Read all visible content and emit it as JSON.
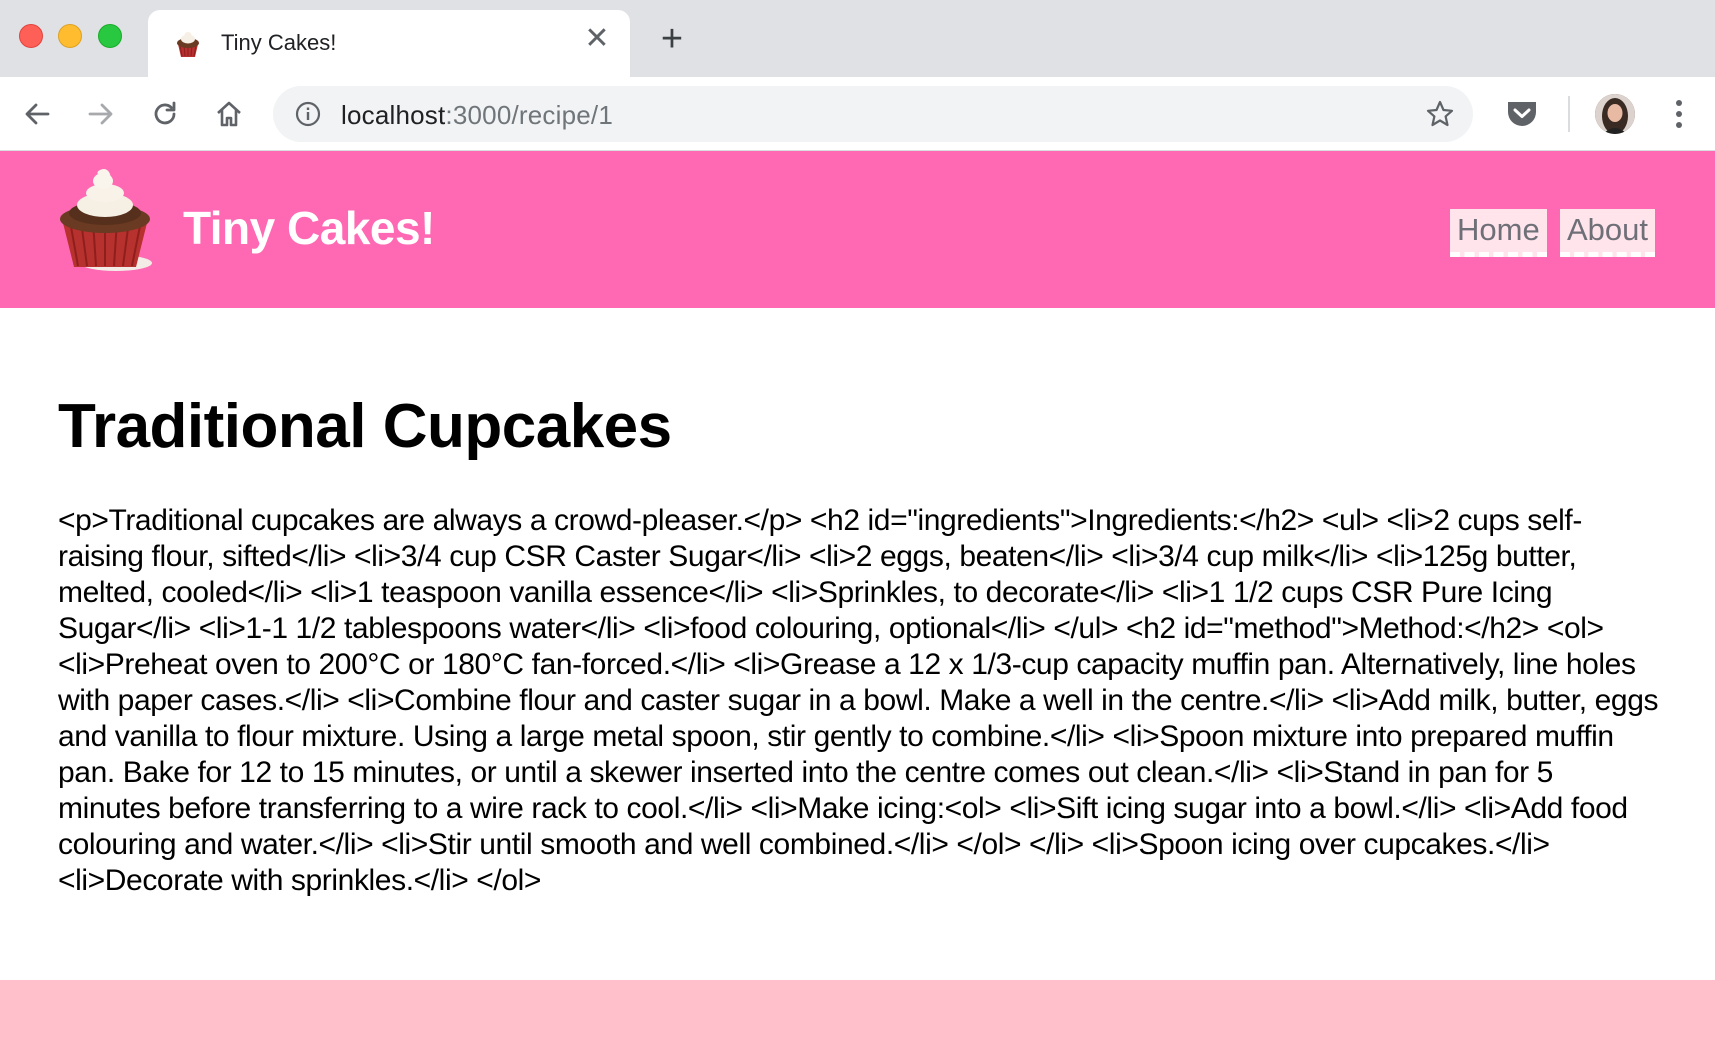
{
  "browser": {
    "tab_title": "Tiny Cakes!",
    "tab_close": "✕",
    "new_tab": "+",
    "url_host": "localhost",
    "url_rest": ":3000/recipe/1"
  },
  "site": {
    "title": "Tiny Cakes!",
    "nav": [
      {
        "label": "Home"
      },
      {
        "label": "About"
      }
    ],
    "brand_color": "#ff69b4",
    "footer_color": "#ffc0cb"
  },
  "recipe": {
    "title": "Traditional Cupcakes",
    "body": "<p>Traditional cupcakes are always a crowd-pleaser.</p> <h2 id=\"ingredients\">Ingredients:</h2> <ul> <li>2 cups self-raising flour, sifted</li> <li>3/4 cup CSR Caster Sugar</li> <li>2 eggs, beaten</li> <li>3/4 cup milk</li> <li>125g butter, melted, cooled</li> <li>1 teaspoon vanilla essence</li> <li>Sprinkles, to decorate</li> <li>1 1/2 cups CSR Pure Icing Sugar</li> <li>1-1 1/2 tablespoons water</li> <li>food colouring, optional</li> </ul> <h2 id=\"method\">Method:</h2> <ol> <li>Preheat oven to 200°C or 180°C fan-forced.</li> <li>Grease a 12 x 1/3-cup capacity muffin pan. Alternatively, line holes with paper cases.</li> <li>Combine flour and caster sugar in a bowl. Make a well in the centre.</li> <li>Add milk, butter, eggs and vanilla to flour mixture. Using a large metal spoon, stir gently to combine.</li> <li>Spoon mixture into prepared muffin pan. Bake for 12 to 15 minutes, or until a skewer inserted into the centre comes out clean.</li> <li>Stand in pan for 5 minutes before transferring to a wire rack to cool.</li> <li>Make icing:<ol> <li>Sift icing sugar into a bowl.</li> <li>Add food colouring and water.</li> <li>Stir until smooth and well combined.</li> </ol> </li> <li>Spoon icing over cupcakes.</li> <li>Decorate with sprinkles.</li> </ol>"
  }
}
